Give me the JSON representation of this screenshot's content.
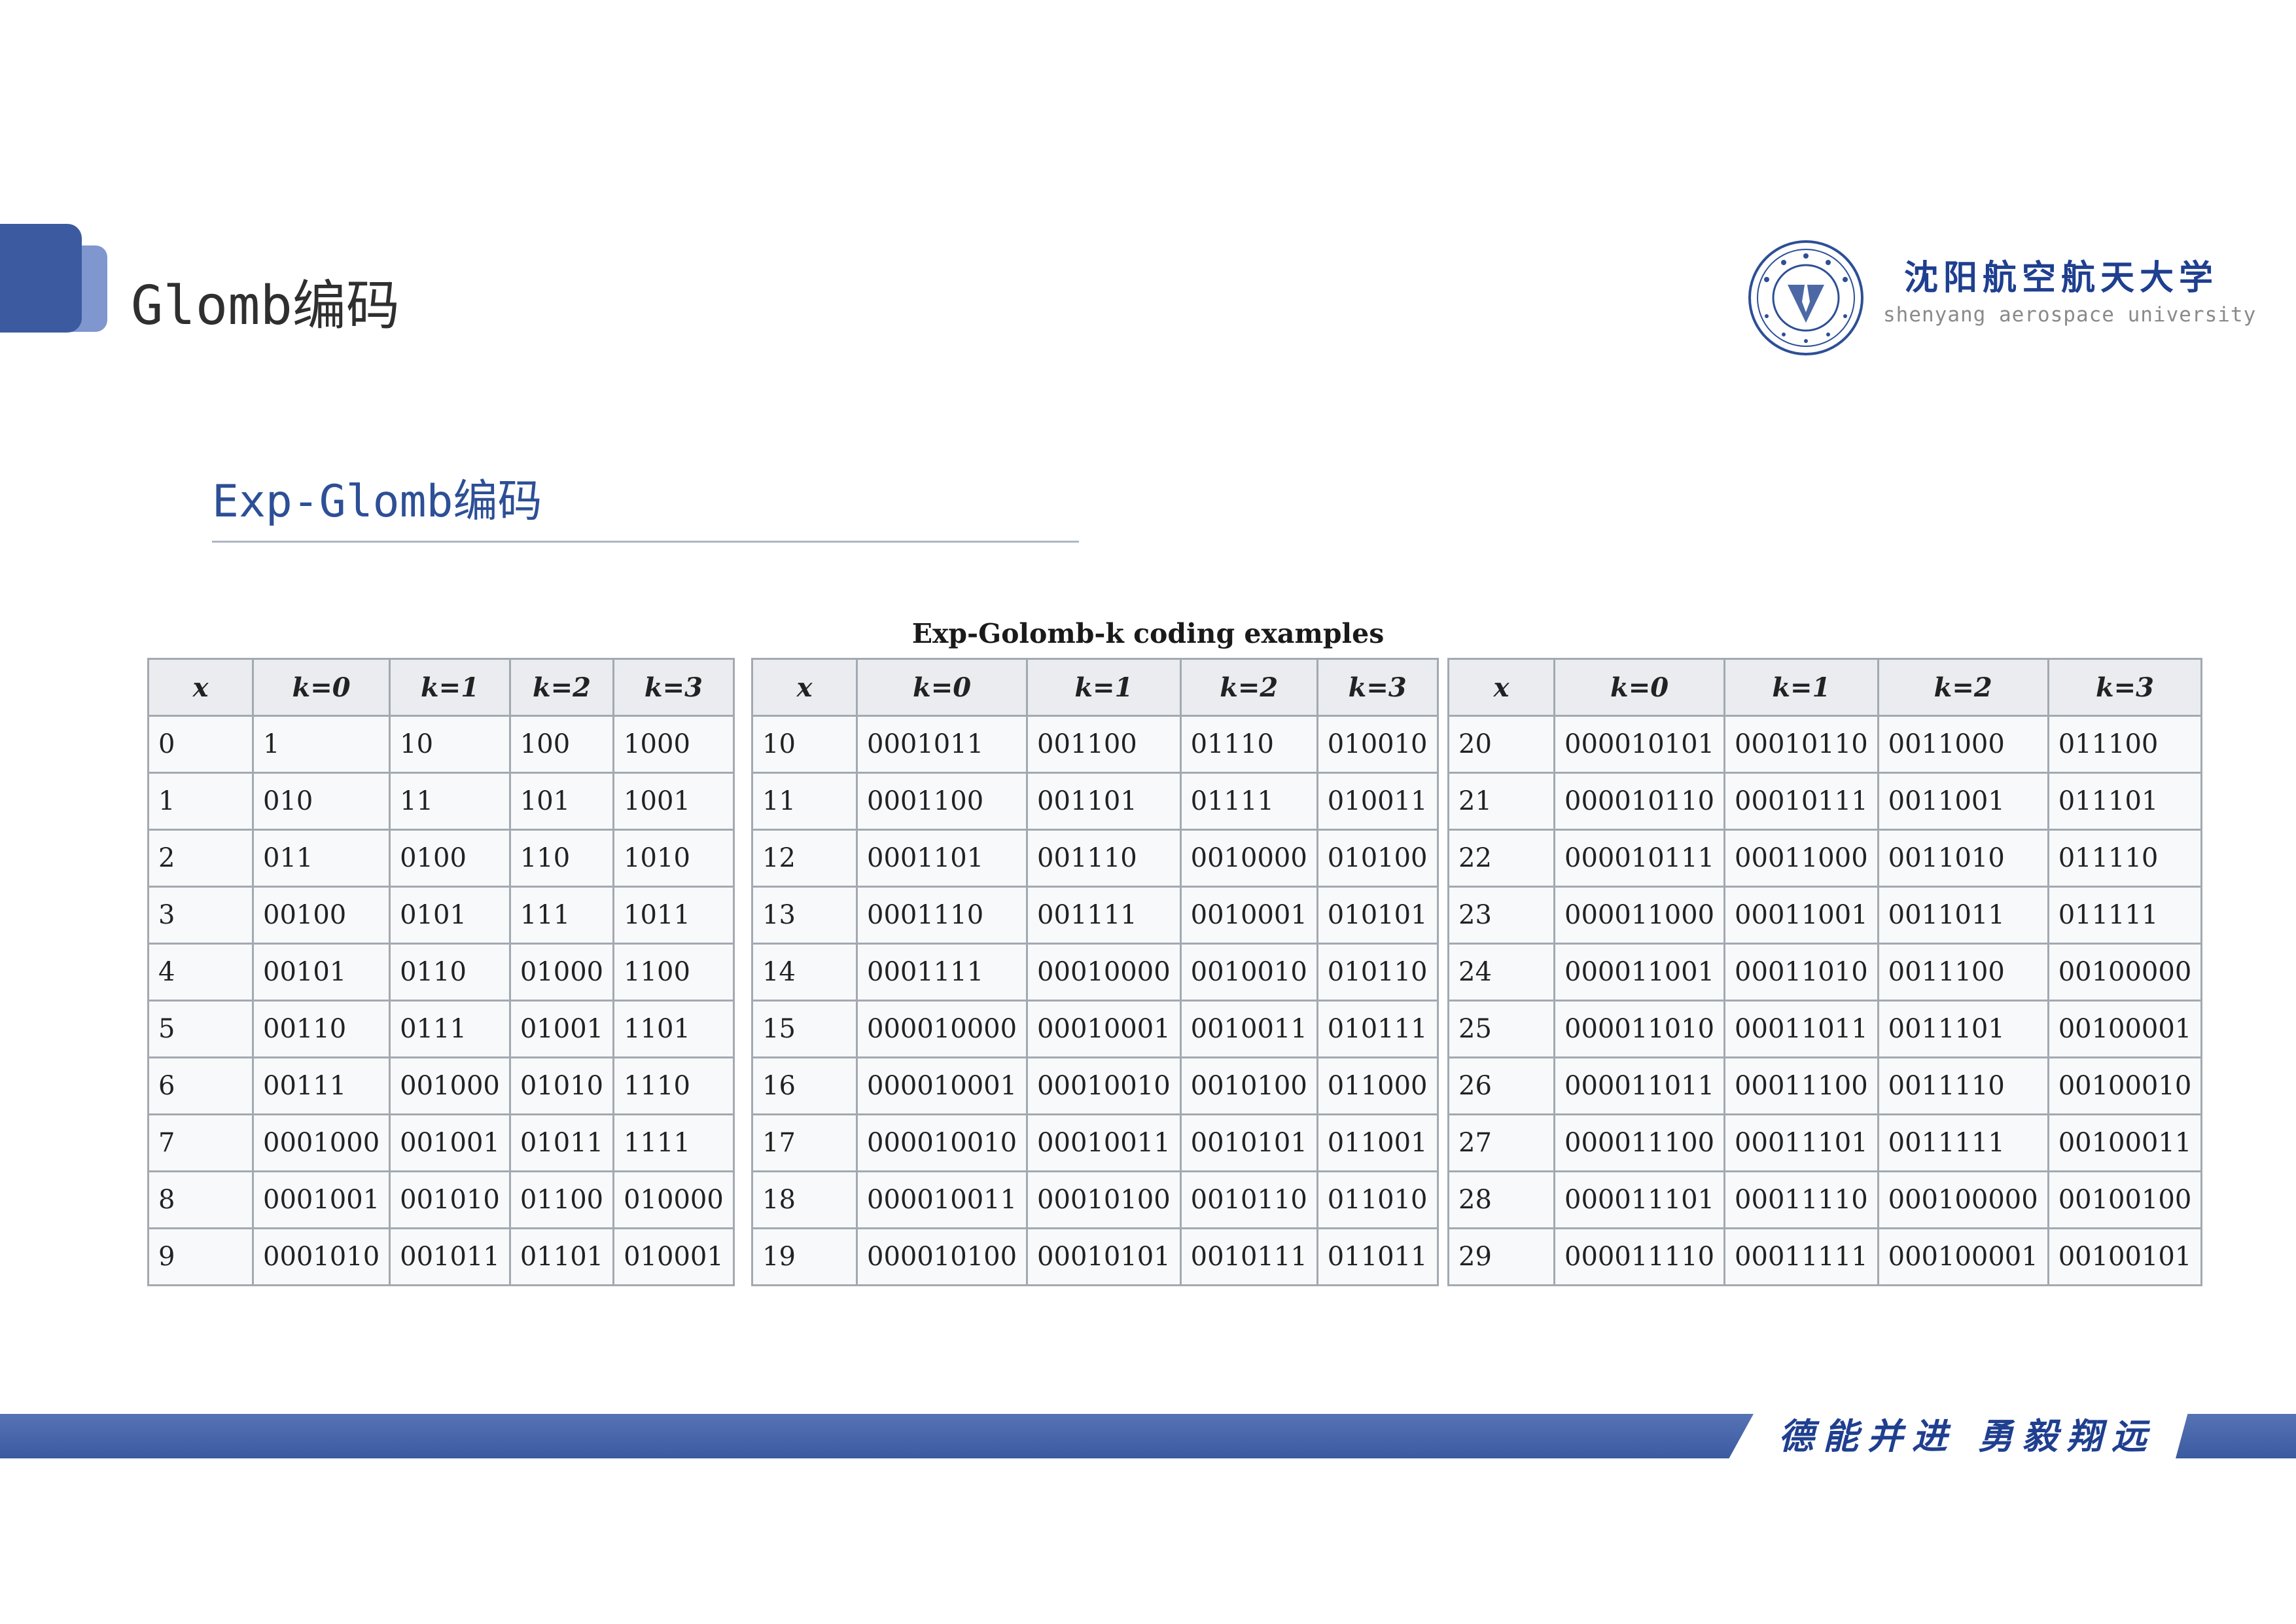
{
  "header": {
    "title": "Glomb编码",
    "university_cn": "沈阳航空航天大学",
    "university_en": "shenyang aerospace university"
  },
  "section": {
    "title": "Exp-Glomb编码"
  },
  "table": {
    "caption": "Exp-Golomb-k coding examples",
    "headers": [
      "x",
      "k=0",
      "k=1",
      "k=2",
      "k=3"
    ],
    "groups": [
      {
        "rows": [
          [
            "0",
            "1",
            "10",
            "100",
            "1000"
          ],
          [
            "1",
            "010",
            "11",
            "101",
            "1001"
          ],
          [
            "2",
            "011",
            "0100",
            "110",
            "1010"
          ],
          [
            "3",
            "00100",
            "0101",
            "111",
            "1011"
          ],
          [
            "4",
            "00101",
            "0110",
            "01000",
            "1100"
          ],
          [
            "5",
            "00110",
            "0111",
            "01001",
            "1101"
          ],
          [
            "6",
            "00111",
            "001000",
            "01010",
            "1110"
          ],
          [
            "7",
            "0001000",
            "001001",
            "01011",
            "1111"
          ],
          [
            "8",
            "0001001",
            "001010",
            "01100",
            "010000"
          ],
          [
            "9",
            "0001010",
            "001011",
            "01101",
            "010001"
          ]
        ]
      },
      {
        "rows": [
          [
            "10",
            "0001011",
            "001100",
            "01110",
            "010010"
          ],
          [
            "11",
            "0001100",
            "001101",
            "01111",
            "010011"
          ],
          [
            "12",
            "0001101",
            "001110",
            "0010000",
            "010100"
          ],
          [
            "13",
            "0001110",
            "001111",
            "0010001",
            "010101"
          ],
          [
            "14",
            "0001111",
            "00010000",
            "0010010",
            "010110"
          ],
          [
            "15",
            "000010000",
            "00010001",
            "0010011",
            "010111"
          ],
          [
            "16",
            "000010001",
            "00010010",
            "0010100",
            "011000"
          ],
          [
            "17",
            "000010010",
            "00010011",
            "0010101",
            "011001"
          ],
          [
            "18",
            "000010011",
            "00010100",
            "0010110",
            "011010"
          ],
          [
            "19",
            "000010100",
            "00010101",
            "0010111",
            "011011"
          ]
        ]
      },
      {
        "rows": [
          [
            "20",
            "000010101",
            "00010110",
            "0011000",
            "011100"
          ],
          [
            "21",
            "000010110",
            "00010111",
            "0011001",
            "011101"
          ],
          [
            "22",
            "000010111",
            "00011000",
            "0011010",
            "011110"
          ],
          [
            "23",
            "000011000",
            "00011001",
            "0011011",
            "011111"
          ],
          [
            "24",
            "000011001",
            "00011010",
            "0011100",
            "00100000"
          ],
          [
            "25",
            "000011010",
            "00011011",
            "0011101",
            "00100001"
          ],
          [
            "26",
            "000011011",
            "00011100",
            "0011110",
            "00100010"
          ],
          [
            "27",
            "000011100",
            "00011101",
            "0011111",
            "00100011"
          ],
          [
            "28",
            "000011101",
            "00011110",
            "000100000",
            "00100100"
          ],
          [
            "29",
            "000011110",
            "00011111",
            "000100001",
            "00100101"
          ]
        ]
      }
    ]
  },
  "footer": {
    "motto": "德能并进 勇毅翔远"
  },
  "colors": {
    "brand_blue": "#3c5aa0",
    "brand_blue_light": "#7f96cf",
    "title_blue": "#2d4f96",
    "motto_blue": "#1f3f8f",
    "header_cell": "#eaecf0",
    "body_cell": "#f8f9fa",
    "table_border": "#a2a9b1"
  }
}
